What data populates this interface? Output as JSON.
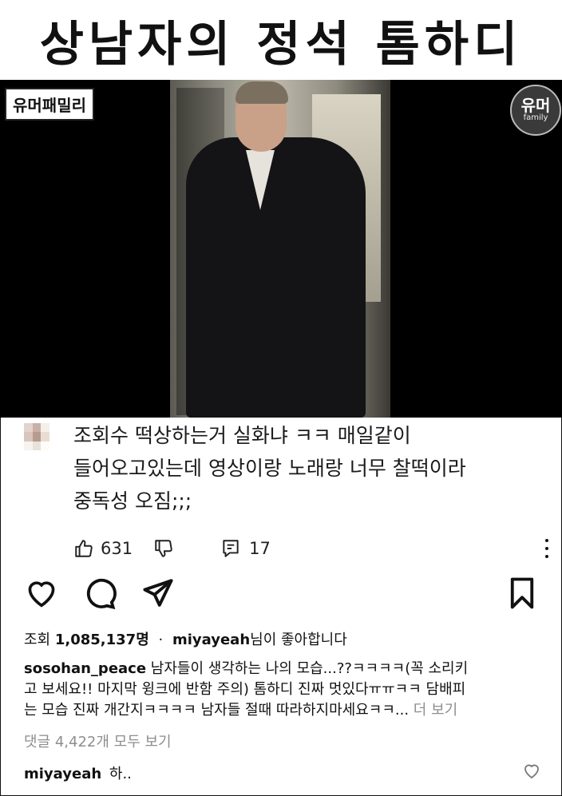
{
  "headline": "상남자의 정석 톰하디",
  "video": {
    "channel_badge": "유머패밀리",
    "logo_main": "유머",
    "logo_sub": "family"
  },
  "comment": {
    "lines": [
      "조회수 떡상하는거 실화냐 ㅋㅋ 매일같이",
      "들어오고있는데 영상이랑 노래랑 너무 찰떡이라",
      "중독성 오짐;;;"
    ],
    "likes": "631",
    "replies": "17"
  },
  "post": {
    "views_prefix": "조회",
    "views_count": "1,085,137명",
    "separator": "·",
    "liked_by_user": "miyayeah",
    "liked_suffix": "님이 좋아합니다",
    "caption_user": "sosohan_peace",
    "caption_line1": "남자들이 생각하는 나의 모습...??ㅋㅋㅋㅋ(꼭 소리키",
    "caption_line2": "고 보세요!! 마지막 윙크에 반함 주의) 톰하디 진짜 멋있다ㅠㅠㅋㅋ 담배피",
    "caption_line3": "는 모습 진짜 개간지ㅋㅋㅋㅋ 남자들 절때 따라하지마세요ㅋㅋ...",
    "more_label": "더 보기",
    "view_all_comments": "댓글 4,422개 모두 보기",
    "reply_user": "miyayeah",
    "reply_text": "하.."
  },
  "colors": {
    "text": "#111111",
    "muted": "#8e8e8e",
    "video_bg": "#000000"
  }
}
